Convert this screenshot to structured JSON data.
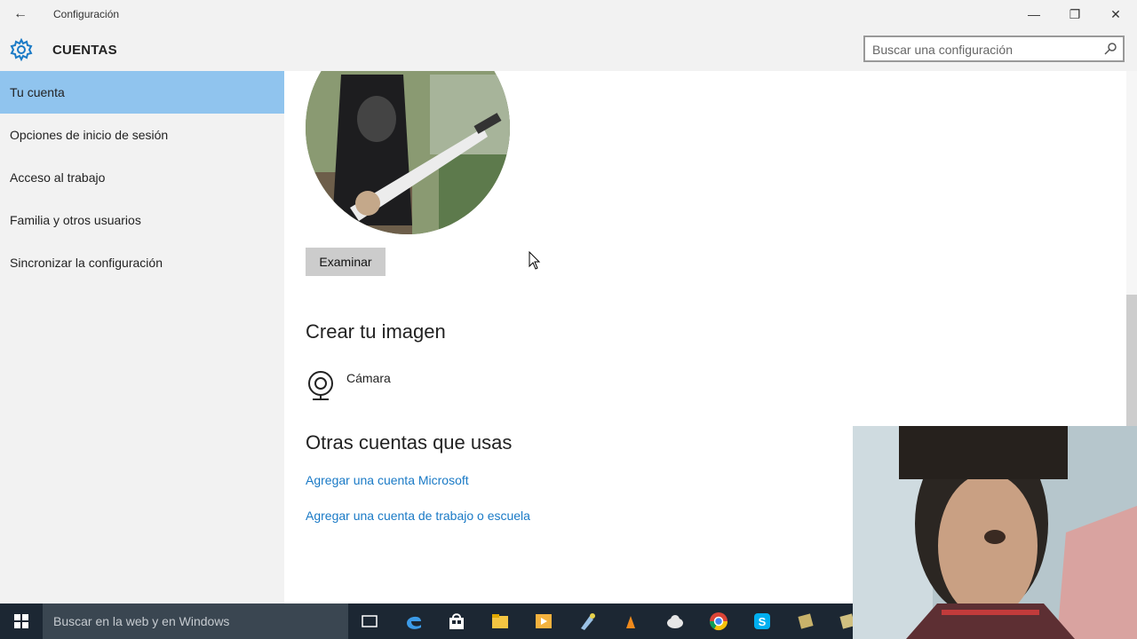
{
  "window": {
    "title": "Configuración",
    "section_title": "CUENTAS",
    "search_placeholder": "Buscar una configuración"
  },
  "sidebar": {
    "items": [
      {
        "label": "Tu cuenta",
        "active": true
      },
      {
        "label": "Opciones de inicio de sesión",
        "active": false
      },
      {
        "label": "Acceso al trabajo",
        "active": false
      },
      {
        "label": "Familia y otros usuarios",
        "active": false
      },
      {
        "label": "Sincronizar la configuración",
        "active": false
      }
    ]
  },
  "main": {
    "browse_button": "Examinar",
    "create_heading": "Crear tu imagen",
    "camera_label": "Cámara",
    "other_accounts_heading": "Otras cuentas que usas",
    "links": [
      "Agregar una cuenta Microsoft",
      "Agregar una cuenta de trabajo o escuela"
    ]
  },
  "taskbar": {
    "search_placeholder": "Buscar en la web y en Windows",
    "icons": [
      "task-view-icon",
      "edge-icon",
      "store-icon",
      "file-explorer-icon",
      "media-player-icon",
      "paint-icon",
      "vlc-icon",
      "cloud-icon",
      "chrome-icon",
      "skype-icon",
      "app-icon",
      "app-icon-2"
    ]
  },
  "colors": {
    "accent": "#1a7ac6",
    "selected_nav": "#90c4ee",
    "chrome_bg": "#f2f2f2",
    "taskbar": "#1c2733"
  }
}
